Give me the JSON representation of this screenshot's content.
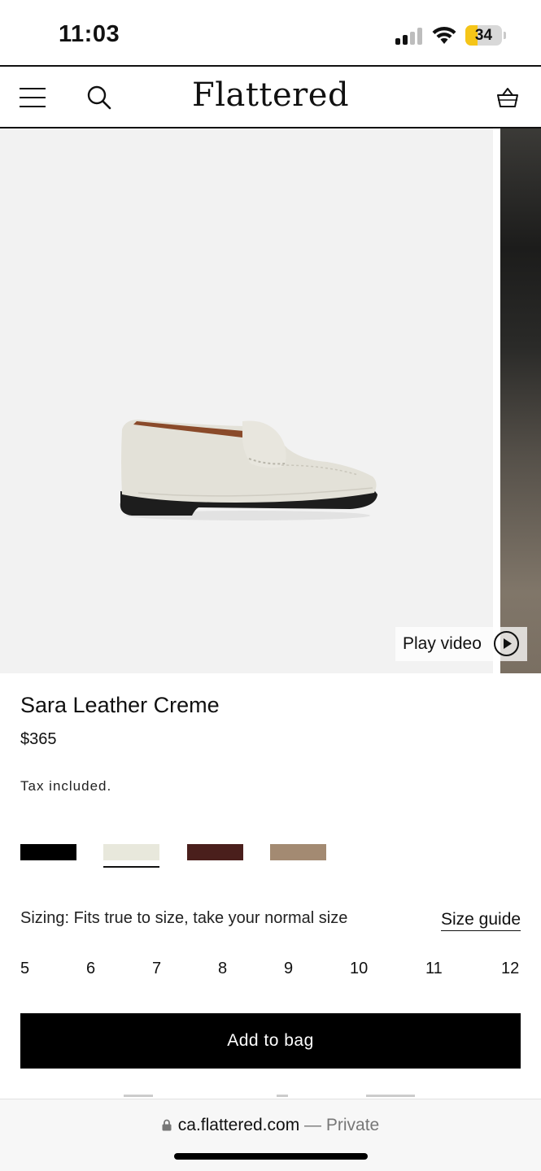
{
  "status": {
    "time": "11:03",
    "battery_level": "34",
    "battery_fraction": 0.34
  },
  "header": {
    "brand": "Flattered",
    "icons": [
      "menu-icon",
      "search-icon",
      "cart-icon"
    ]
  },
  "gallery": {
    "play_video_label": "Play video",
    "icons": [
      "play-icon"
    ]
  },
  "product": {
    "title": "Sara Leather Creme",
    "price": "$365",
    "tax_note": "Tax included.",
    "colors": [
      {
        "name": "black",
        "hex": "#000000",
        "selected": false
      },
      {
        "name": "creme",
        "hex": "#e8e8dc",
        "selected": true
      },
      {
        "name": "brown",
        "hex": "#4a1f1c",
        "selected": false
      },
      {
        "name": "taupe",
        "hex": "#a38a72",
        "selected": false
      }
    ],
    "sizing_note": "Sizing: Fits true to size, take your normal size",
    "size_guide_label": "Size guide",
    "sizes": [
      "5",
      "6",
      "7",
      "8",
      "9",
      "10",
      "11",
      "12"
    ],
    "add_to_bag_label": "Add to bag"
  },
  "browser": {
    "domain": "ca.flattered.com",
    "separator": " — ",
    "mode": "Private",
    "icons": [
      "lock-icon"
    ]
  }
}
